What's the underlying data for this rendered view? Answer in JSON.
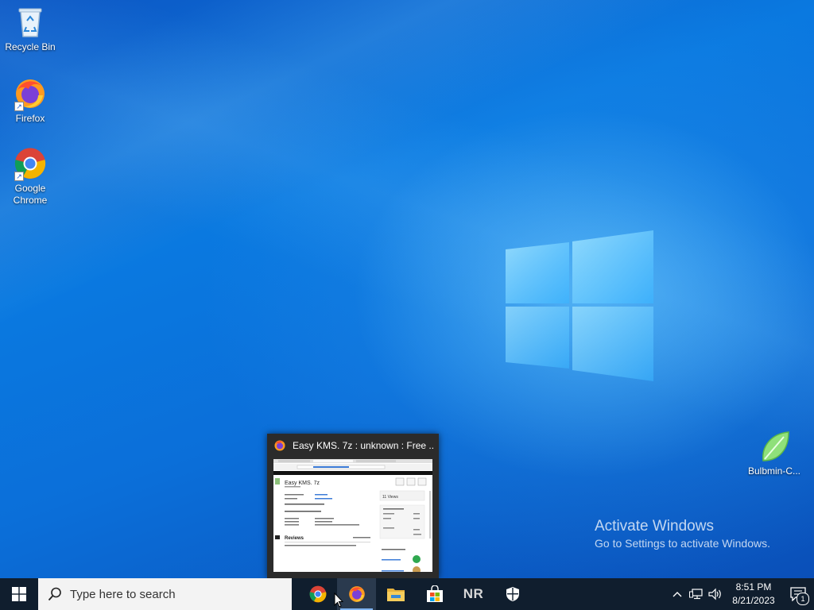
{
  "desktop": {
    "icons": [
      {
        "label": "Recycle Bin",
        "icon": "recycle-bin-icon"
      },
      {
        "label": "Firefox",
        "icon": "firefox-icon"
      },
      {
        "label": "Google Chrome",
        "icon": "chrome-icon"
      },
      {
        "label": "Bulbmin-C...",
        "icon": "leaf-icon"
      }
    ],
    "activation": {
      "title": "Activate Windows",
      "subtitle": "Go to Settings to activate Windows."
    }
  },
  "preview": {
    "title": "Easy KMS. 7z : unknown : Free ...",
    "app_icon": "firefox-icon",
    "page_heading": "Easy KMS. 7z",
    "reviews_label": "Reviews",
    "views_label": "11 Views"
  },
  "taskbar": {
    "search_placeholder": "Type here to search",
    "apps": [
      {
        "name": "Google Chrome",
        "icon": "chrome-icon",
        "active": false
      },
      {
        "name": "Firefox",
        "icon": "firefox-icon",
        "active": true
      },
      {
        "name": "File Explorer",
        "icon": "folder-icon",
        "active": false
      },
      {
        "name": "Microsoft Store",
        "icon": "store-icon",
        "active": false
      },
      {
        "name": "NR",
        "label": "NR",
        "icon": "nr-icon",
        "active": false
      },
      {
        "name": "Windows Security",
        "icon": "shield-icon",
        "active": false
      }
    ],
    "clock": {
      "time": "8:51 PM",
      "date": "8/21/2023"
    },
    "notifications_count": "1"
  },
  "colors": {
    "taskbar": "#101e2e",
    "desktop_blue": "#0a63c9",
    "search_bg": "#f3f3f3"
  }
}
